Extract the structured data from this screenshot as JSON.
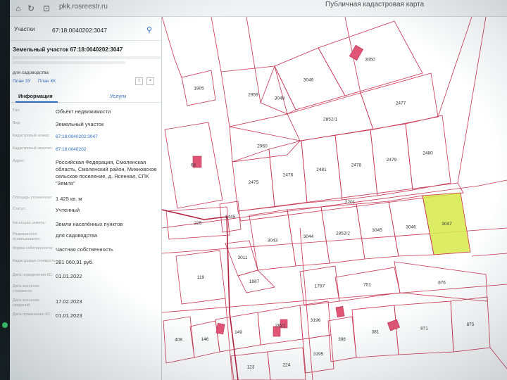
{
  "browser": {
    "url": "pkk.rosreestr.ru",
    "map_title": "Публичная кадастровая карта"
  },
  "search": {
    "category": "Участки",
    "query": "67:18:0040202:3047"
  },
  "parcel": {
    "title": "Земельный участок 67:18:0040202:3047",
    "purpose": "для садоводства",
    "plan_zu": "План ЗУ",
    "plan_kk": "План КК"
  },
  "tabs": {
    "info": "Информация",
    "services": "Услуги"
  },
  "details": [
    {
      "key": "Тип:",
      "value": "Объект недвижимости"
    },
    {
      "key": "Вид:",
      "value": "Земельный участок"
    },
    {
      "key": "Кадастровый номер:",
      "value": "67:18:0040202:3047"
    },
    {
      "key": "Кадастровый квартал:",
      "value": "67:18:0040202"
    },
    {
      "key": "Адрес:",
      "value": "Российская Федерация, Смоленская область, Смоленский район, Михновское сельское поселение, д. Ясенная, СПК \"Земля\""
    },
    {
      "key": "Площадь уточненная:",
      "value": "1 425 кв. м"
    },
    {
      "key": "Статус:",
      "value": "Учтенный"
    },
    {
      "key": "Категория земель:",
      "value": "Земли населённых пунктов"
    },
    {
      "key": "Разрешенное использование:",
      "value": "для садоводства"
    },
    {
      "key": "Форма собственности:",
      "value": "Частная собственность"
    },
    {
      "key": "Кадастровая стоимость:",
      "value": "281 060,91 руб."
    },
    {
      "key": "Дата определения КС:",
      "value": "01.01.2022"
    },
    {
      "key": "Дата внесения стоимости:",
      "value": ""
    },
    {
      "key": "Дата внесения сведений:",
      "value": "17.02.2023"
    },
    {
      "key": "Дата применения КС:",
      "value": "01.01.2023"
    }
  ],
  "map": {
    "selected_parcel": "3047",
    "selected_color": "#d6ea4a",
    "boundary_color": "#c8324f",
    "building_color": "#e05576",
    "labels": [
      "3050",
      "3049",
      "3048",
      "2477",
      "1905",
      "2959",
      "2852/1",
      "2960",
      "2480",
      "2479",
      "2478",
      "2481",
      "2476",
      "2475",
      "68",
      "2201",
      "3047",
      "3046",
      "3045",
      "2852/2",
      "3044",
      "3043",
      "225",
      "1445",
      "876",
      "3011",
      "1987",
      "701",
      "1797",
      "875",
      "871",
      "381",
      "398",
      "3196",
      "3195",
      "2821",
      "149",
      "146",
      "408",
      "224",
      "123",
      "119"
    ]
  }
}
